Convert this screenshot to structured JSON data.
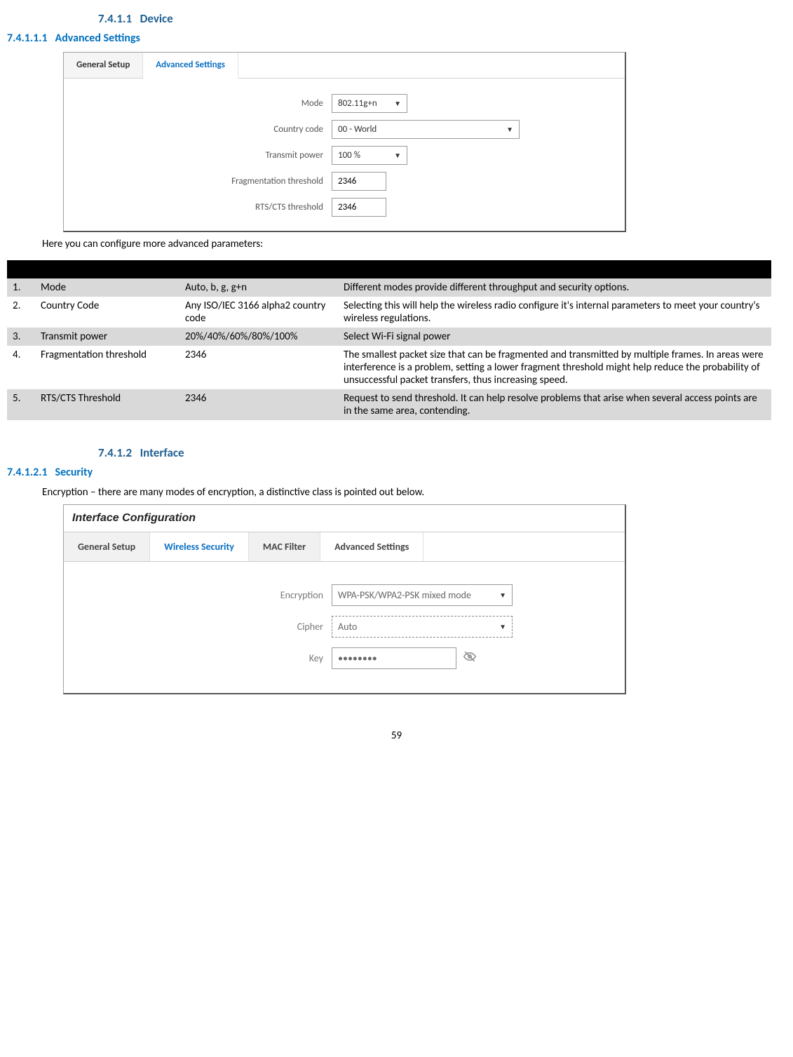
{
  "headings": {
    "device_num": "7.4.1.1",
    "device_title": "Device",
    "adv_num": "7.4.1.1.1",
    "adv_title": "Advanced Settings",
    "interface_num": "7.4.1.2",
    "interface_title": "Interface",
    "security_num": "7.4.1.2.1",
    "security_title": "Security"
  },
  "panel1": {
    "tabs": {
      "general": "General Setup",
      "advanced": "Advanced Settings"
    },
    "fields": {
      "mode_label": "Mode",
      "mode_value": "802.11g+n",
      "country_label": "Country code",
      "country_value": "00 - World",
      "tx_label": "Transmit power",
      "tx_value": "100 %",
      "frag_label": "Fragmentation threshold",
      "frag_value": "2346",
      "rts_label": "RTS/CTS threshold",
      "rts_value": "2346"
    }
  },
  "intro1": "Here you can configure more advanced parameters:",
  "table": {
    "headers": {
      "num": "",
      "name": "",
      "sample": "",
      "expl": ""
    },
    "rows": [
      {
        "n": "1.",
        "name": "Mode",
        "sample": "Auto, b, g, g+n",
        "expl": "Different modes provide different throughput and security options."
      },
      {
        "n": "2.",
        "name": "Country Code",
        "sample": "Any ISO/IEC 3166 alpha2 country code",
        "expl": "Selecting this will help the wireless radio configure it's internal parameters to meet your country's wireless regulations."
      },
      {
        "n": "3.",
        "name": "Transmit power",
        "sample": "20%/40%/60%/80%/100%",
        "expl": "Select Wi-Fi signal power"
      },
      {
        "n": "4.",
        "name": "Fragmentation threshold",
        "sample": "2346",
        "expl": "The smallest packet size that can be fragmented and transmitted by multiple frames. In areas were interference is a problem, setting a lower fragment threshold might help reduce the probability of unsuccessful packet transfers, thus increasing speed."
      },
      {
        "n": "5.",
        "name": "RTS/CTS Threshold",
        "sample": "2346",
        "expl": "Request to send threshold. It can help resolve problems that arise when several access points are in the same area, contending."
      }
    ]
  },
  "intro2": "Encryption – there are many modes of encryption, a distinctive class is pointed out below.",
  "panel2": {
    "title": "Interface Configuration",
    "tabs": {
      "general": "General Setup",
      "ws": "Wireless Security",
      "mac": "MAC Filter",
      "adv": "Advanced Settings"
    },
    "fields": {
      "enc_label": "Encryption",
      "enc_value": "WPA-PSK/WPA2-PSK mixed mode",
      "cipher_label": "Cipher",
      "cipher_value": "Auto",
      "key_label": "Key",
      "key_value": "••••••••"
    }
  },
  "page_number": "59"
}
